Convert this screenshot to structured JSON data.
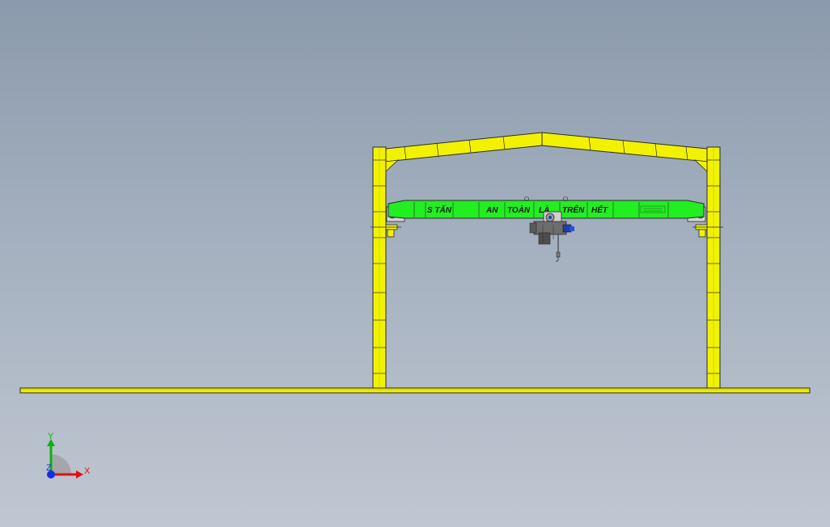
{
  "viewport": {
    "background_top": "#8b9aac",
    "background_bottom": "#c0c7d2"
  },
  "model": {
    "frame_color": "#f2f200",
    "beam_color": "#22ee22",
    "outline_color": "#2a2a2a",
    "hoist_color": "#6d6d6d",
    "motor_color": "#1f3fb0"
  },
  "crane_beam": {
    "words": [
      "S TẤN",
      "AN",
      "TOÀN",
      "LÀ",
      "TRÊN",
      "HẾT"
    ]
  },
  "triad": {
    "x_label": "X",
    "y_label": "Y",
    "z_label": "Z",
    "x_color": "#e01010",
    "y_color": "#10b010",
    "z_color": "#1030e0"
  }
}
